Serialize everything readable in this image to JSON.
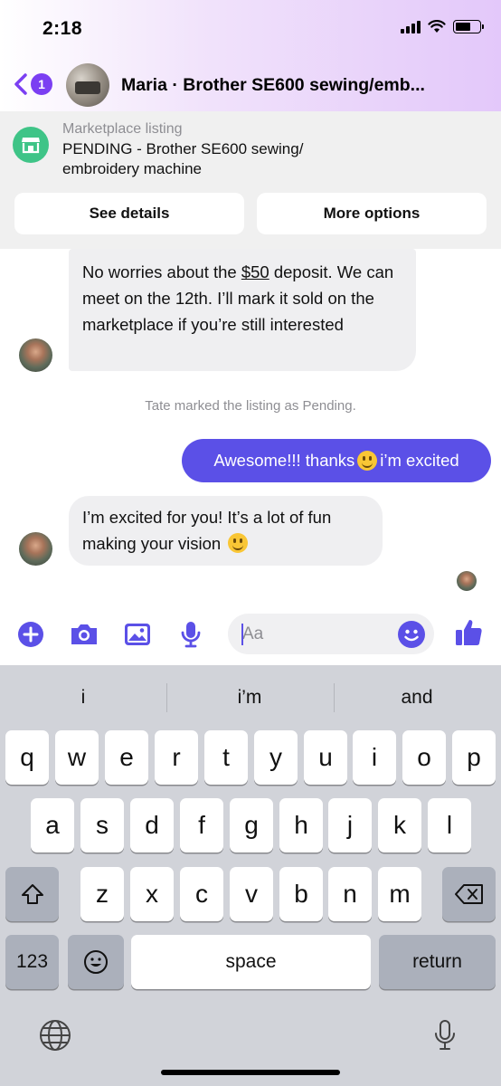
{
  "status_bar": {
    "time": "2:18"
  },
  "header": {
    "back_count": "1",
    "title": "Maria · Brother SE600 sewing/emb..."
  },
  "listing": {
    "label": "Marketplace listing",
    "title": "PENDING - Brother SE600 sewing/ embroidery machine",
    "see_details": "See details",
    "more_options": "More options"
  },
  "messages": {
    "m1_pre": "No worries about the ",
    "m1_link": "$50",
    "m1_post": " deposit. We can meet on the 12th. I’ll mark it sold on the marketplace if you’re still interested",
    "system_note": "Tate marked the listing as Pending.",
    "m2_pre": "Awesome!!! thanks ",
    "m2_post": " i’m excited",
    "m3": "I’m excited for you! It’s a lot of fun making your vision "
  },
  "composer": {
    "placeholder": "Aa"
  },
  "keyboard": {
    "suggestions": [
      "i",
      "i’m",
      "and"
    ],
    "row1": [
      "q",
      "w",
      "e",
      "r",
      "t",
      "y",
      "u",
      "i",
      "o",
      "p"
    ],
    "row2": [
      "a",
      "s",
      "d",
      "f",
      "g",
      "h",
      "j",
      "k",
      "l"
    ],
    "row3": [
      "z",
      "x",
      "c",
      "v",
      "b",
      "n",
      "m"
    ],
    "num_key": "123",
    "space": "space",
    "return": "return"
  },
  "colors": {
    "accent": "#5b50e7",
    "back_badge": "#7b3ff2",
    "marketplace_green": "#3fc487"
  },
  "icons": [
    "back-chevron-icon",
    "marketplace-shop-icon",
    "plus-icon",
    "camera-icon",
    "image-icon",
    "microphone-icon",
    "emoji-icon",
    "thumbs-up-icon",
    "shift-icon",
    "backspace-icon",
    "globe-icon",
    "dictation-mic-icon"
  ]
}
